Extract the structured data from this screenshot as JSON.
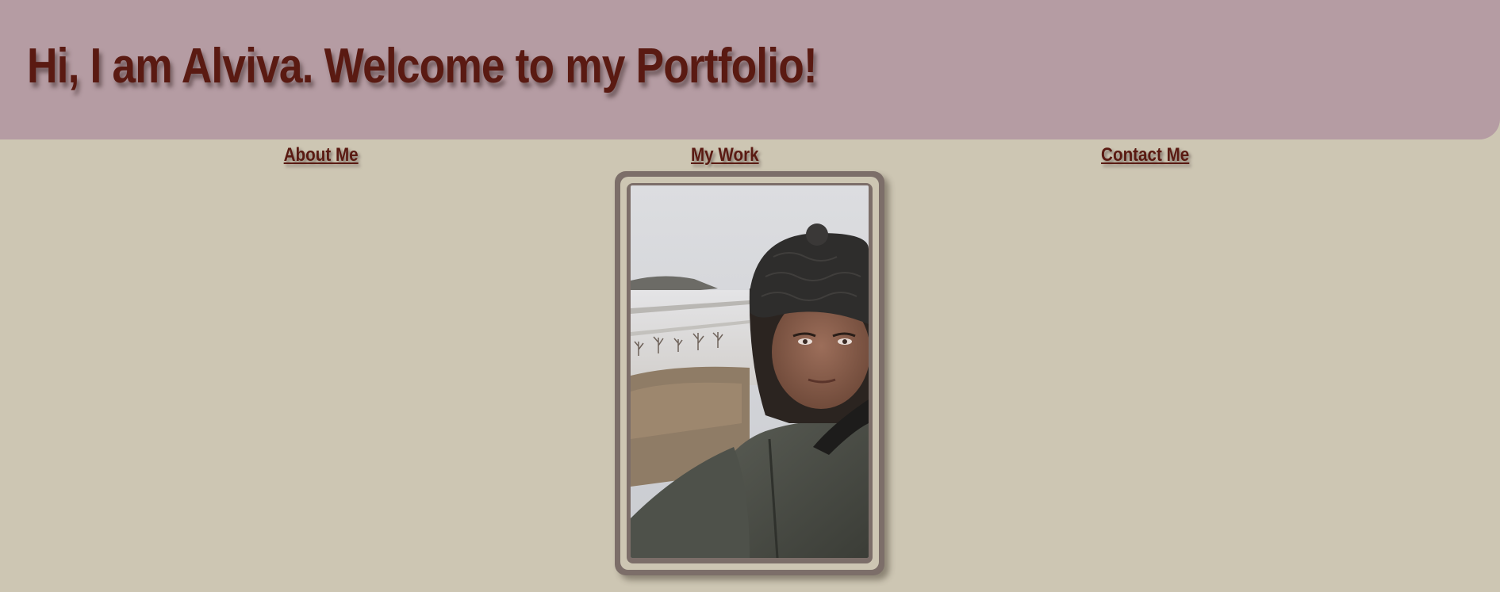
{
  "header": {
    "title": "Hi, I am Alviva. Welcome to my Portfolio!"
  },
  "nav": {
    "about": "About Me",
    "work": "My Work",
    "contact": "Contact Me"
  },
  "colors": {
    "background": "#cdc6b3",
    "header_background": "#b59ca3",
    "text": "#5a1a12",
    "frame": "#7c6e69"
  },
  "photo": {
    "subject": "portrait-selfie-winter-landscape"
  }
}
